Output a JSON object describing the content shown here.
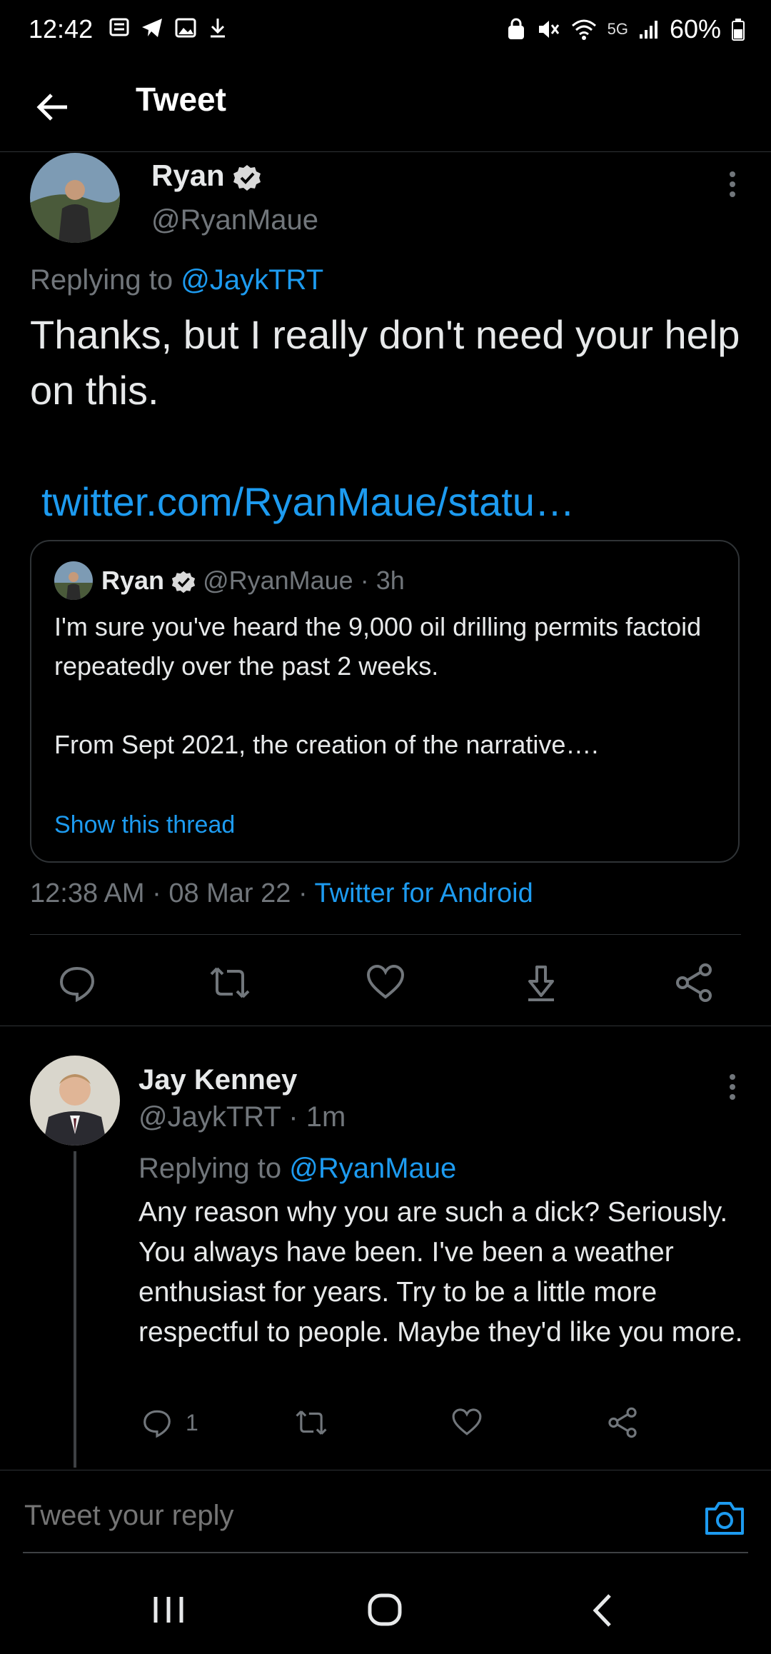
{
  "status_bar": {
    "time": "12:42",
    "network": "5G",
    "battery": "60%"
  },
  "header": {
    "title": "Tweet"
  },
  "main_tweet": {
    "name": "Ryan",
    "handle": "@RyanMaue",
    "replying_prefix": "Replying to",
    "replying_to": "@JaykTRT",
    "text": "Thanks, but I really don't need your help on this.",
    "url": "twitter.com/RyanMaue/statu…",
    "quote": {
      "name": "Ryan",
      "handle": "@RyanMaue",
      "time": "· 3h",
      "text_line1": "I'm sure you've heard the 9,000 oil drilling permits factoid repeatedly over the past 2 weeks.",
      "text_line2": "From Sept 2021, the creation of the narrative….",
      "show_thread": "Show this thread"
    },
    "meta_time": "12:38 AM · 08 Mar 22 ·",
    "meta_source": "Twitter for Android"
  },
  "reply_tweet": {
    "name": "Jay Kenney",
    "handle": "@JaykTRT",
    "time": "· 1m",
    "replying_prefix": "Replying to",
    "replying_to": "@RyanMaue",
    "text": "Any reason why you are such a dick? Seriously. You always have been. I've been a weather enthusiast for years. Try to be a little more respectful to people. Maybe they'd like you more.",
    "reply_count": "1"
  },
  "composer": {
    "placeholder": "Tweet your reply"
  },
  "colors": {
    "accent": "#1d9bf0",
    "muted": "#71767b",
    "background": "#000000"
  }
}
